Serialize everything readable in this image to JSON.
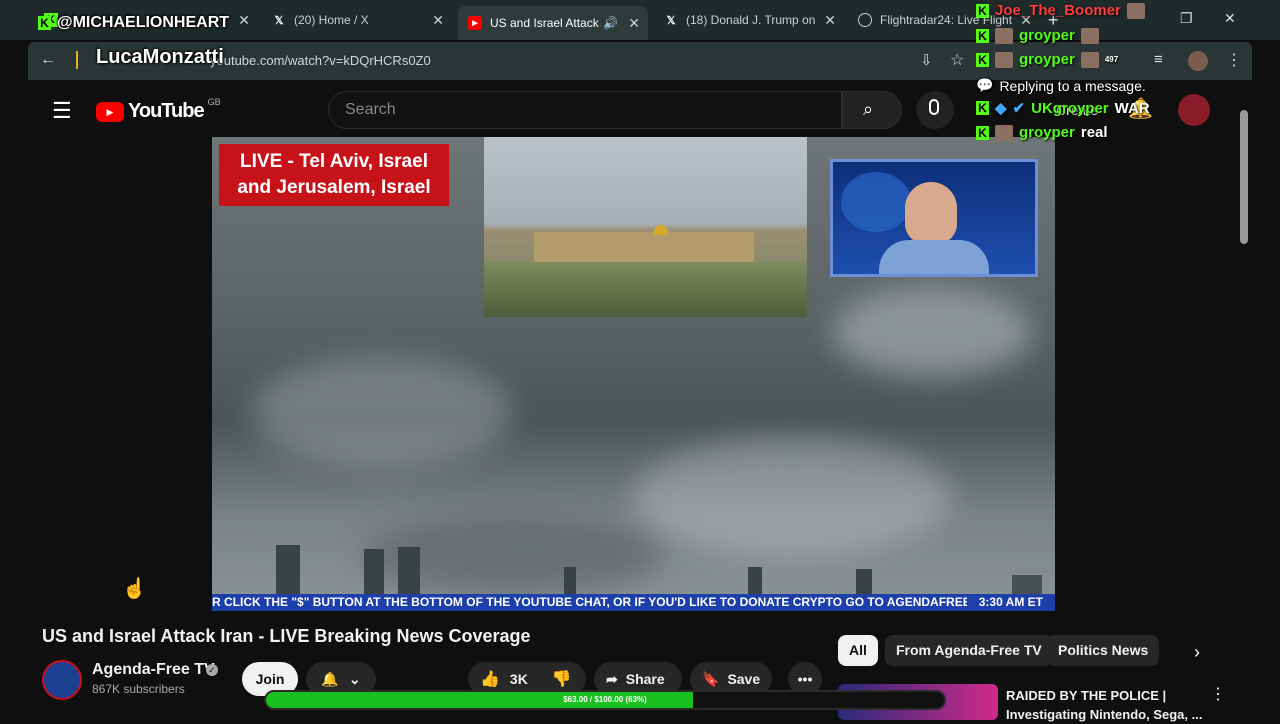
{
  "browser": {
    "tabs": [
      {
        "label": "",
        "icon": "kick-icon"
      },
      {
        "label": "(20) Home / X",
        "icon": "x-icon"
      },
      {
        "label": "US and Israel Attack",
        "icon": "youtube-icon",
        "active": true
      },
      {
        "label": "(18) Donald J. Trump on",
        "icon": "x-icon"
      },
      {
        "label": "Flightradar24: Live Flight",
        "icon": "flightradar-icon"
      }
    ],
    "url": "youtube.com/watch?v=kDQrHCRs0Z0",
    "new_tab": "+"
  },
  "youtube": {
    "logo_text": "YouTube",
    "region": "GB",
    "search_placeholder": "Search",
    "create_label": "Create"
  },
  "video": {
    "live_caption_line1": "LIVE - Tel Aviv, Israel",
    "live_caption_line2": "and Jerusalem, Israel",
    "ticker_text": "R CLICK THE \"$\" BUTTON AT THE BOTTOM OF THE YOUTUBE CHAT, OR IF YOU'D LIKE TO DONATE CRYPTO GO TO AGENDAFREETV.CO",
    "ticker_time": "3:30 AM ET",
    "title": "US and Israel Attack Iran - LIVE Breaking News Coverage"
  },
  "channel": {
    "name": "Agenda-Free TV",
    "subscribers": "867K subscribers",
    "join_label": "Join"
  },
  "actions": {
    "likes": "3K",
    "share_label": "Share",
    "save_label": "Save"
  },
  "chips": [
    "All",
    "From Agenda-Free TV",
    "Politics News"
  ],
  "recommended": {
    "title": "RAIDED BY THE POLICE | Investigating Nintendo, Sega, ..."
  },
  "overlay": {
    "handle": "@MICHAELIONHEART",
    "streamer": "LucaMonzatti",
    "chat": [
      {
        "user": "Joe_The_Boomer",
        "text": "",
        "color": "#ff3b3b"
      },
      {
        "user": "groyper",
        "text": "",
        "color": "#53fc18"
      },
      {
        "user": "groyper",
        "text": "",
        "color": "#53fc18",
        "badge": "497"
      },
      {
        "user": "",
        "text": "Replying to a message.",
        "color": "#ffffff"
      },
      {
        "user": "UKgroyper",
        "text": "WAR",
        "color": "#53fc18"
      },
      {
        "user": "groyper",
        "text": "real",
        "color": "#53fc18"
      }
    ],
    "goal": {
      "text": "$63.00 / $100.00 (63%)",
      "progress": 0.63
    }
  },
  "colors": {
    "youtube_red": "#ff0000",
    "kick_green": "#53fc18",
    "live_red": "#c8121a",
    "ticker_blue": "#1c3faa"
  }
}
